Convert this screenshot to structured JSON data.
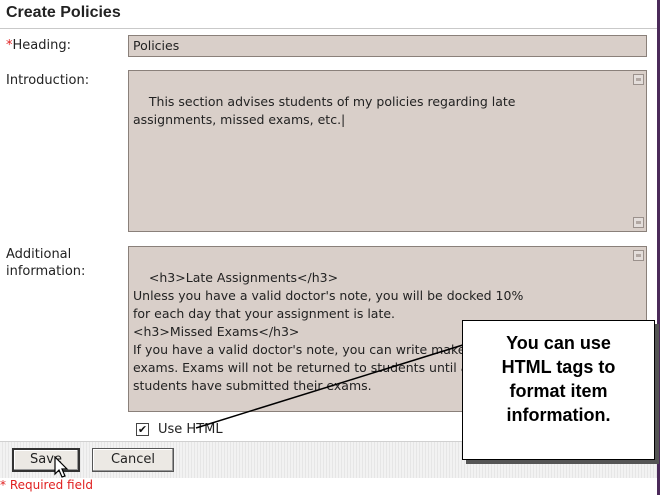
{
  "page": {
    "title": "Create Policies"
  },
  "form": {
    "required_marker": "*",
    "heading": {
      "label": "Heading:",
      "value": "Policies"
    },
    "introduction": {
      "label": "Introduction:",
      "value": "This section advises students of my policies regarding late\nassignments, missed exams, etc.|"
    },
    "additional": {
      "label_line1": "Additional",
      "label_line2": "information:",
      "value": "<h3>Late Assignments</h3>\nUnless you have a valid doctor's note, you will be docked 10%\nfor each day that your assignment is late.\n<h3>Missed Exams</h3>\nIf you have a valid doctor's note, you can write make-up\nexams. Exams will not be returned to students until all\nstudents have submitted their exams."
    },
    "use_html": {
      "label": "Use HTML",
      "checked": true,
      "mark": "✔"
    }
  },
  "buttons": {
    "save": "Save",
    "cancel": "Cancel"
  },
  "footer": {
    "required_note": "* Required field"
  },
  "callout": {
    "line1": "You can use",
    "line2": "HTML tags to",
    "line3": "format item",
    "line4": "information."
  }
}
